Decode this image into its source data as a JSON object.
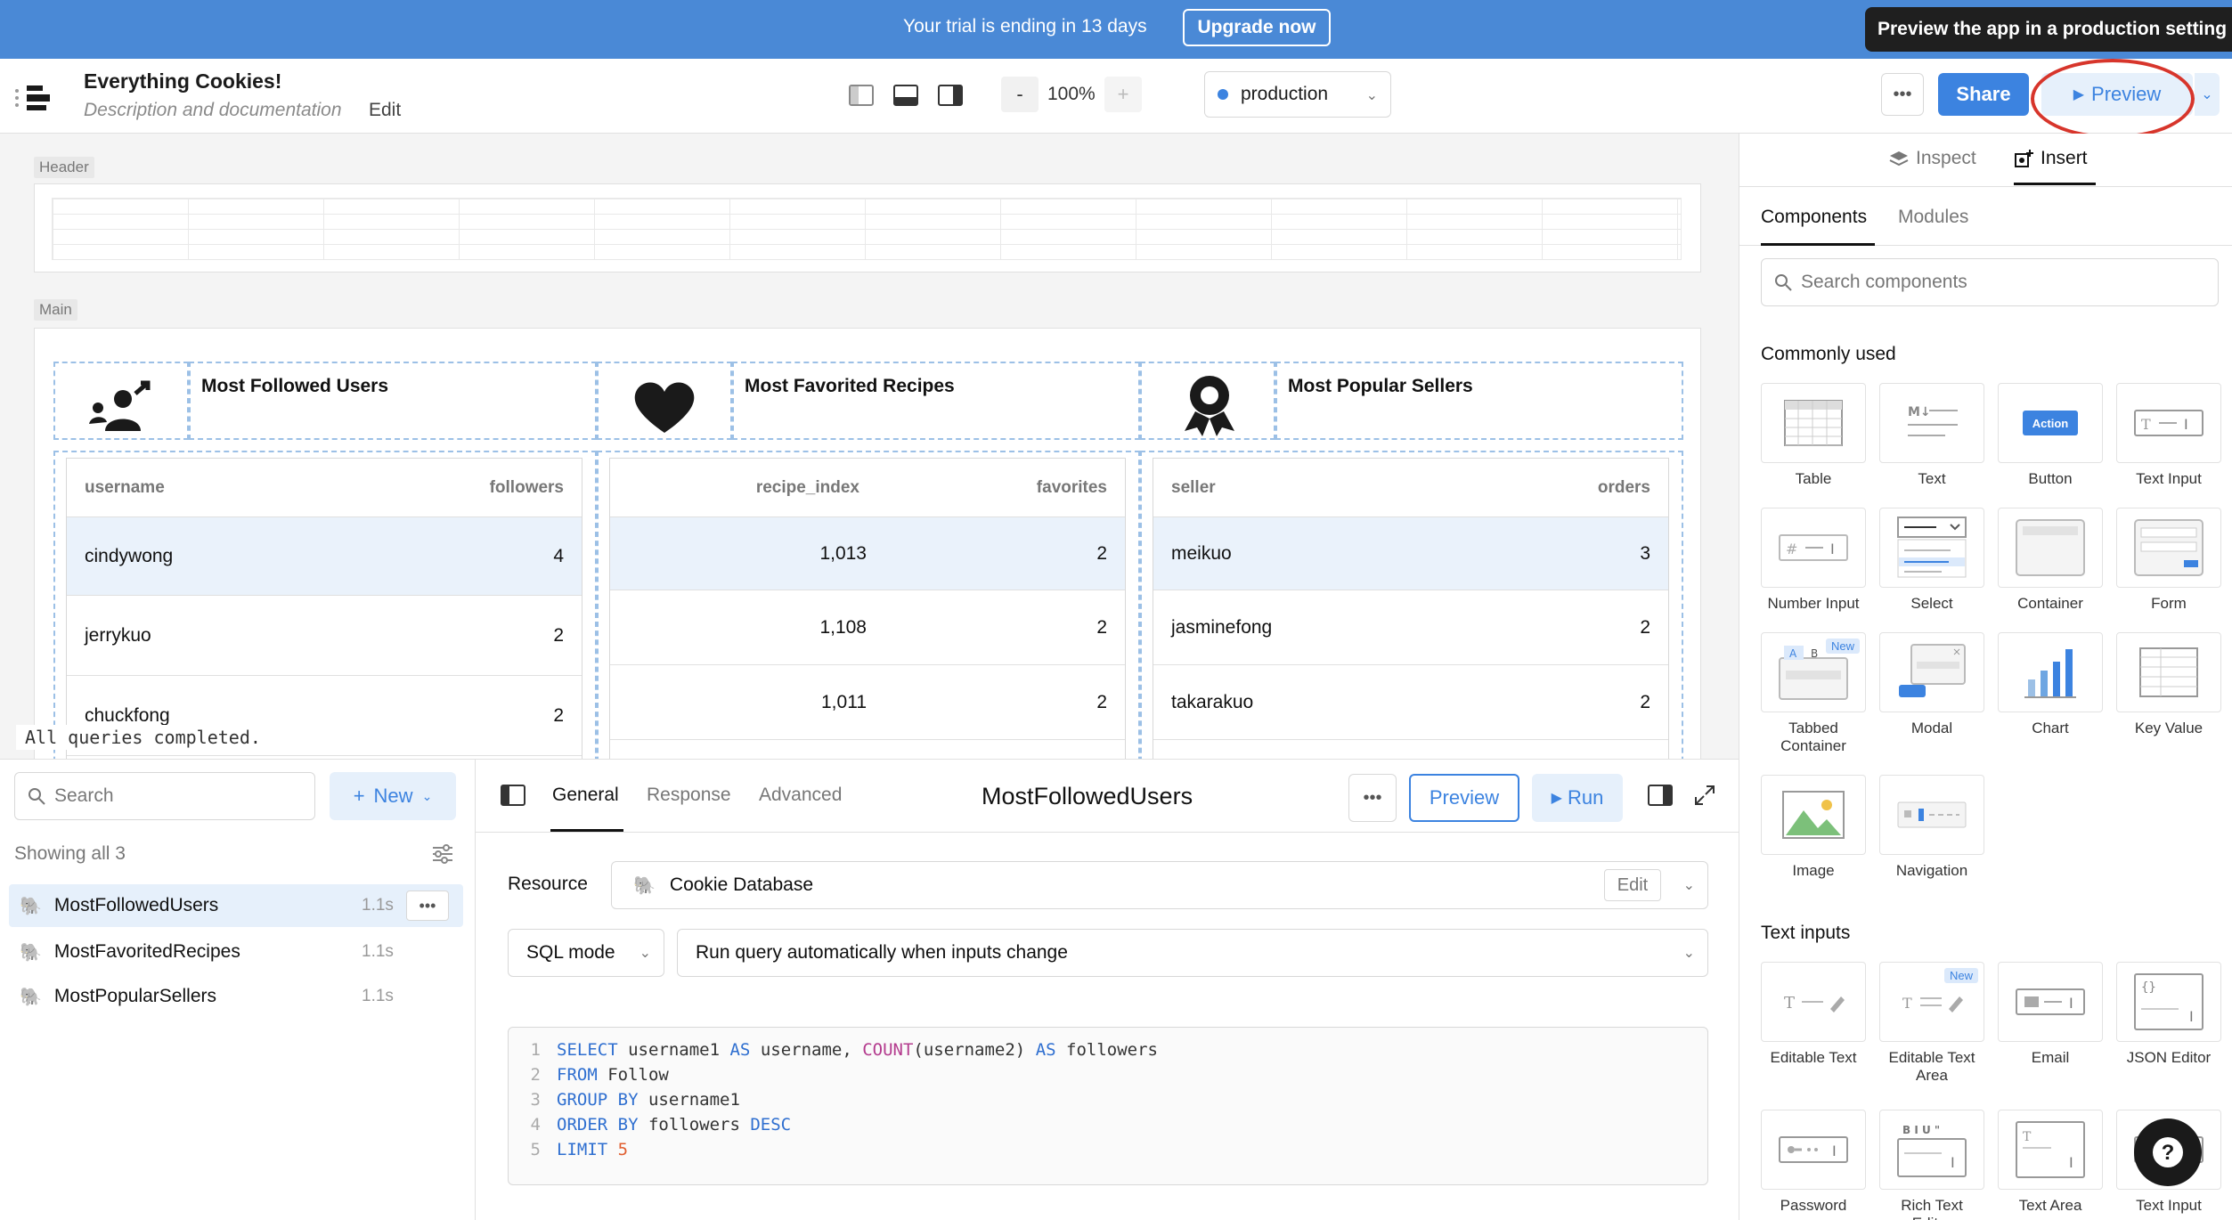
{
  "banner": {
    "trial_text": "Your trial is ending in 13 days",
    "upgrade_label": "Upgrade now",
    "tooltip": "Preview the app in a production setting"
  },
  "toolbar": {
    "app_title": "Everything Cookies!",
    "app_description": "Description and documentation",
    "edit_label": "Edit",
    "zoom_minus": "-",
    "zoom_value": "100%",
    "zoom_plus": "+",
    "environment": "production",
    "share_label": "Share",
    "preview_label": "Preview",
    "accent_color": "#3c83e0"
  },
  "canvas": {
    "header_label": "Header",
    "main_label": "Main",
    "stats": [
      {
        "title": "Most Followed Users",
        "icon": "user-follow-icon"
      },
      {
        "title": "Most Favorited Recipes",
        "icon": "heart-icon"
      },
      {
        "title": "Most Popular Sellers",
        "icon": "award-ribbon-icon"
      }
    ],
    "tables": [
      {
        "headers": [
          "username",
          "followers"
        ],
        "rows": [
          [
            "cindywong",
            "4"
          ],
          [
            "jerrykuo",
            "2"
          ],
          [
            "chuckfong",
            "2"
          ]
        ]
      },
      {
        "headers": [
          "recipe_index",
          "favorites"
        ],
        "rows": [
          [
            "1,013",
            "2"
          ],
          [
            "1,108",
            "2"
          ],
          [
            "1,011",
            "2"
          ]
        ]
      },
      {
        "headers": [
          "seller",
          "orders"
        ],
        "rows": [
          [
            "meikuo",
            "3"
          ],
          [
            "jasminefong",
            "2"
          ],
          [
            "takarakuo",
            "2"
          ]
        ]
      }
    ],
    "status": "All queries completed."
  },
  "queries": {
    "search_placeholder": "Search",
    "new_label": "New",
    "showing": "Showing all 3",
    "items": [
      {
        "name": "MostFollowedUsers",
        "time": "1.1s"
      },
      {
        "name": "MostFavoritedRecipes",
        "time": "1.1s"
      },
      {
        "name": "MostPopularSellers",
        "time": "1.1s"
      }
    ]
  },
  "editor": {
    "tabs": [
      "General",
      "Response",
      "Advanced"
    ],
    "title": "MostFollowedUsers",
    "preview_label": "Preview",
    "run_label": "Run",
    "resource_label": "Resource",
    "resource_value": "Cookie Database",
    "resource_edit": "Edit",
    "mode": "SQL mode",
    "trigger": "Run query automatically when inputs change",
    "code": [
      {
        "n": "1",
        "parts": [
          [
            "kw",
            "SELECT"
          ],
          [
            "ident",
            " username1 "
          ],
          [
            "kw",
            "AS"
          ],
          [
            "ident",
            " username, "
          ],
          [
            "fn",
            "COUNT"
          ],
          [
            "ident",
            "(username2) "
          ],
          [
            "kw",
            "AS"
          ],
          [
            "ident",
            " followers"
          ]
        ]
      },
      {
        "n": "2",
        "parts": [
          [
            "kw",
            "FROM"
          ],
          [
            "ident",
            " Follow"
          ]
        ]
      },
      {
        "n": "3",
        "parts": [
          [
            "kw",
            "GROUP BY"
          ],
          [
            "ident",
            " username1"
          ]
        ]
      },
      {
        "n": "4",
        "parts": [
          [
            "kw",
            "ORDER BY"
          ],
          [
            "ident",
            " followers "
          ],
          [
            "kw",
            "DESC"
          ]
        ]
      },
      {
        "n": "5",
        "parts": [
          [
            "kw",
            "LIMIT"
          ],
          [
            "num",
            " 5"
          ]
        ]
      }
    ]
  },
  "right_panel": {
    "inspect_label": "Inspect",
    "insert_label": "Insert",
    "components_tab": "Components",
    "modules_tab": "Modules",
    "search_placeholder": "Search components",
    "commonly_used_label": "Commonly used",
    "commonly_used": [
      {
        "label": "Table",
        "icon": "table-icon"
      },
      {
        "label": "Text",
        "icon": "text-icon"
      },
      {
        "label": "Button",
        "icon": "button-icon",
        "inner": "Action"
      },
      {
        "label": "Text Input",
        "icon": "text-input-icon"
      },
      {
        "label": "Number Input",
        "icon": "number-input-icon"
      },
      {
        "label": "Select",
        "icon": "select-icon"
      },
      {
        "label": "Container",
        "icon": "container-icon"
      },
      {
        "label": "Form",
        "icon": "form-icon"
      },
      {
        "label": "Tabbed Container",
        "icon": "tabbed-container-icon",
        "badge": "New"
      },
      {
        "label": "Modal",
        "icon": "modal-icon"
      },
      {
        "label": "Chart",
        "icon": "chart-icon"
      },
      {
        "label": "Key Value",
        "icon": "key-value-icon"
      },
      {
        "label": "Image",
        "icon": "image-icon"
      },
      {
        "label": "Navigation",
        "icon": "navigation-icon"
      }
    ],
    "text_inputs_label": "Text inputs",
    "text_inputs": [
      {
        "label": "Editable Text",
        "icon": "editable-text-icon"
      },
      {
        "label": "Editable Text Area",
        "icon": "editable-text-area-icon",
        "badge": "New"
      },
      {
        "label": "Email",
        "icon": "email-icon"
      },
      {
        "label": "JSON Editor",
        "icon": "json-editor-icon"
      },
      {
        "label": "Password",
        "icon": "password-icon"
      },
      {
        "label": "Rich Text Editor",
        "icon": "rich-text-editor-icon"
      },
      {
        "label": "Text Area",
        "icon": "text-area-icon"
      },
      {
        "label": "Text Input",
        "icon": "text-input-icon"
      }
    ]
  }
}
